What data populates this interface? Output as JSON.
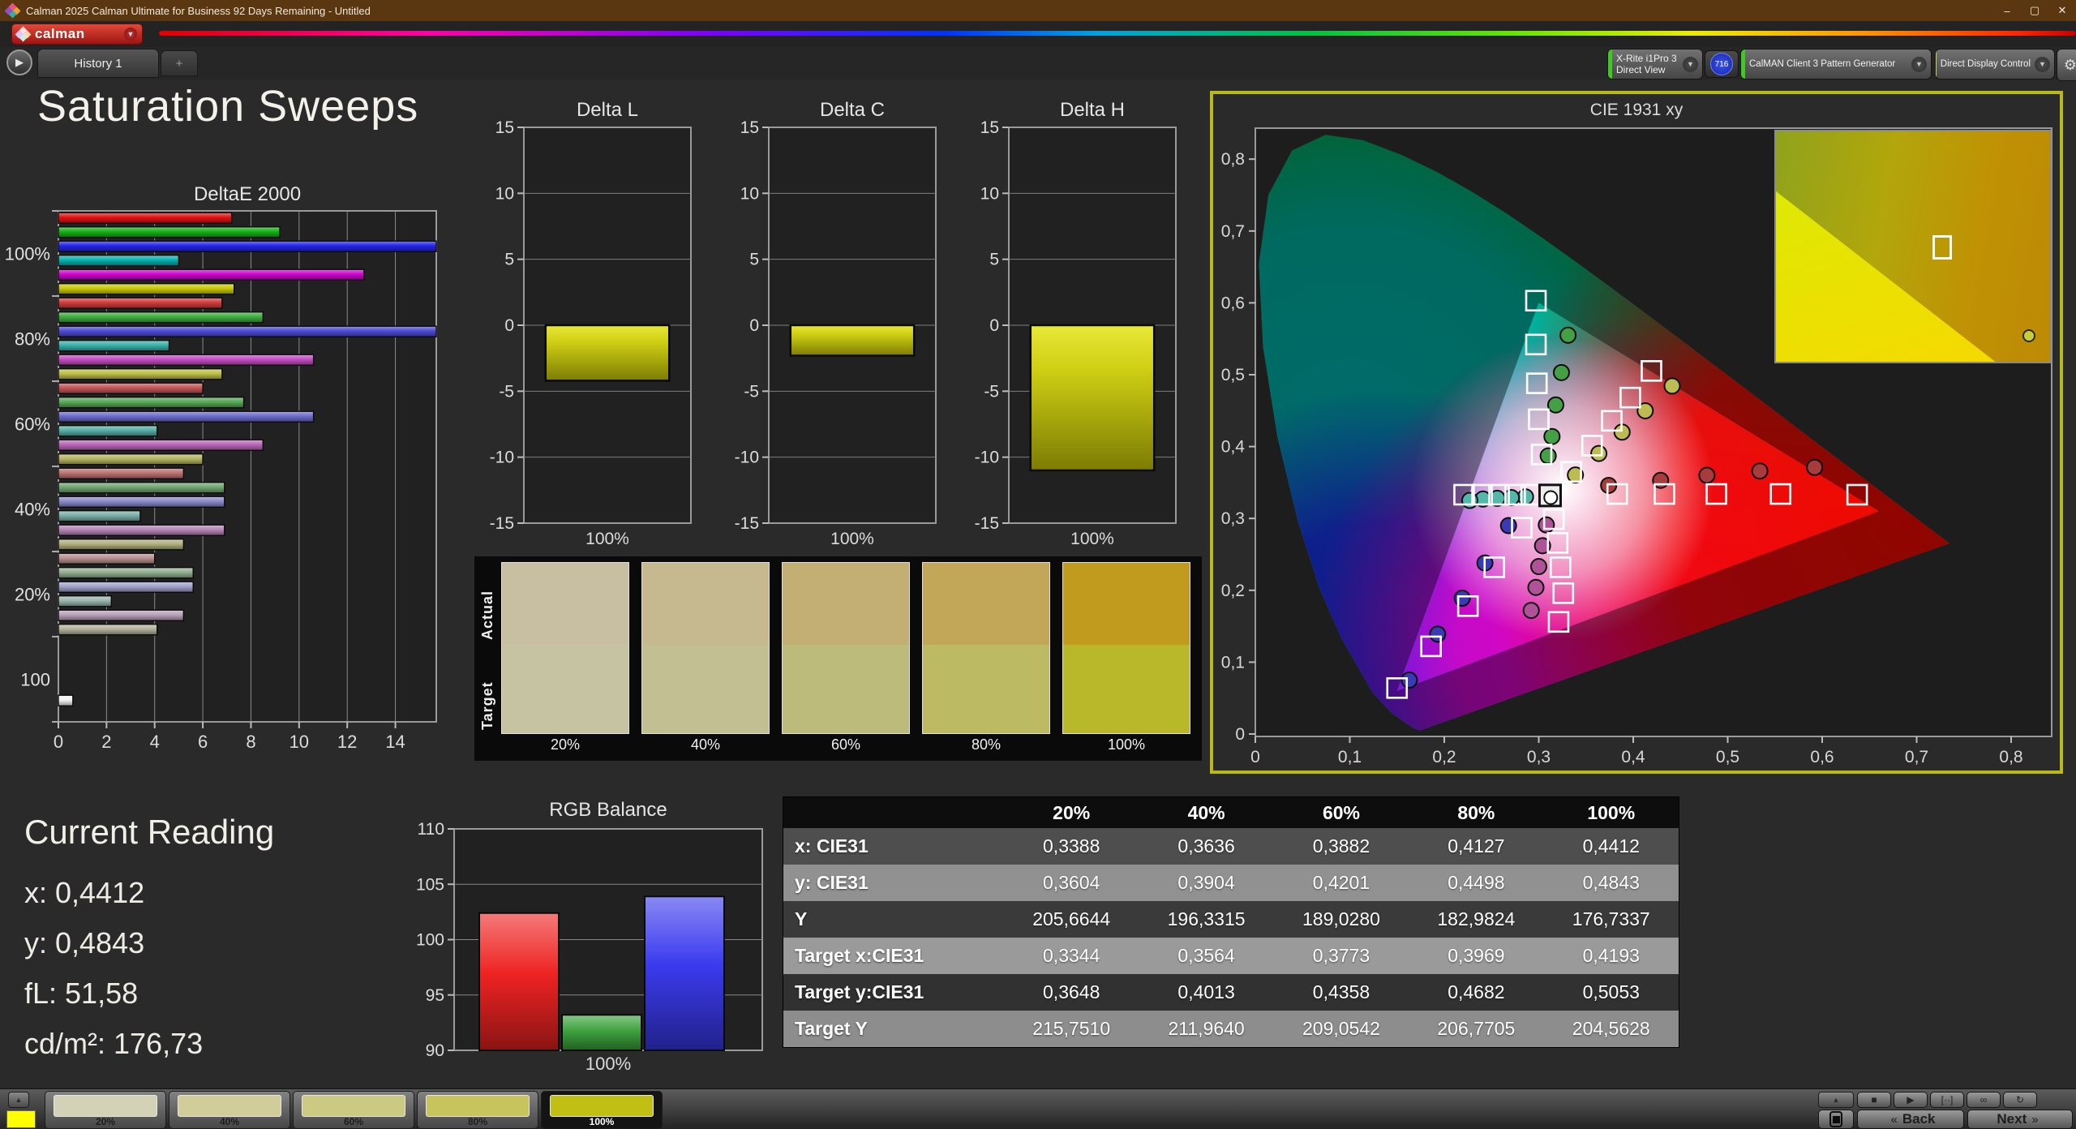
{
  "window": {
    "title": "Calman 2025 Calman Ultimate for Business 92 Days Remaining  - Untitled",
    "controls": {
      "minimize": "–",
      "maximize": "▢",
      "close": "✕"
    }
  },
  "menubar": {
    "brand": "calman"
  },
  "tabbar": {
    "history_tab": "History 1",
    "add_tab": "+"
  },
  "devicebar": {
    "meter": {
      "line1": "X-Rite i1Pro 3",
      "line2": "Direct View",
      "accent": "#3ecb1e"
    },
    "meter_badge": "716",
    "pattern_generator": {
      "label": "CalMAN Client 3 Pattern Generator",
      "accent": "#3ecb1e"
    },
    "display_control": {
      "label": "Direct Display Control",
      "accent": "#e3d600"
    }
  },
  "page": {
    "title": "Saturation Sweeps"
  },
  "current_reading": {
    "title": "Current Reading",
    "lines": [
      "x: 0,4412",
      "y: 0,4843",
      "fL: 51,58",
      "cd/m²: 176,73"
    ]
  },
  "transport": {
    "back": "Back",
    "next": "Next",
    "back_chev": "«",
    "next_chev": "»",
    "icons": [
      "■",
      "▶",
      "[··]",
      "∞",
      "↻"
    ]
  },
  "patterns": {
    "swatch_color": "#ffff00",
    "active_index": 4,
    "items": [
      {
        "label": "20%",
        "color": "#d4d2b6"
      },
      {
        "label": "40%",
        "color": "#d0cd9b"
      },
      {
        "label": "60%",
        "color": "#cbc982"
      },
      {
        "label": "80%",
        "color": "#c7c45e"
      },
      {
        "label": "100%",
        "color": "#c1be14"
      }
    ]
  },
  "chart_data": [
    {
      "id": "deltae",
      "type": "bar",
      "orientation": "horizontal",
      "title": "DeltaE 2000",
      "groups": [
        "100%",
        "80%",
        "60%",
        "40%",
        "20%",
        "100"
      ],
      "series_names": [
        "red",
        "green",
        "blue",
        "cyan",
        "magenta",
        "yellow"
      ],
      "values": [
        [
          7.2,
          9.2,
          16,
          5.0,
          12.7,
          7.3
        ],
        [
          6.8,
          8.5,
          16,
          4.6,
          10.6,
          6.8
        ],
        [
          6.0,
          7.7,
          10.6,
          4.1,
          8.5,
          6.0
        ],
        [
          5.2,
          6.9,
          6.9,
          3.4,
          6.9,
          5.2
        ],
        [
          4.0,
          5.6,
          5.6,
          2.2,
          5.2,
          4.1
        ],
        [
          0.6
        ]
      ],
      "colors": [
        [
          "#e11212",
          "#16b216",
          "#2424ea",
          "#06b2b2",
          "#ce06ce",
          "#c9c906"
        ],
        [
          "#d23c3c",
          "#3fae3f",
          "#4c4cd8",
          "#3ab2ac",
          "#c44ec4",
          "#bfbf48"
        ],
        [
          "#c65656",
          "#57a957",
          "#6c6cce",
          "#57b0a8",
          "#bb68bb",
          "#b6b663"
        ],
        [
          "#bf7272",
          "#72a872",
          "#8a8ac9",
          "#7ab0a8",
          "#b586b5",
          "#b1b180"
        ],
        [
          "#ba9191",
          "#92b092",
          "#a2a2cc",
          "#9ab4ae",
          "#b9a2b9",
          "#b3b39c"
        ],
        [
          "#f4f4f4"
        ]
      ],
      "xticks": [
        0,
        2,
        4,
        6,
        8,
        10,
        12,
        14
      ],
      "xmax": 15.7,
      "grid": true
    },
    {
      "id": "delta_l",
      "type": "bar",
      "title": "Delta L",
      "xlabel": "100%",
      "value": -4.2,
      "ylim": [
        -15,
        15
      ],
      "yticks": [
        15,
        10,
        5,
        0,
        -5,
        -10,
        -15
      ],
      "bar_top": "#e8e838",
      "bar_mid": "#cfcf14",
      "bar_bottom": "#7c7c04"
    },
    {
      "id": "delta_c",
      "type": "bar",
      "title": "Delta C",
      "xlabel": "100%",
      "value": -2.3,
      "ylim": [
        -15,
        15
      ],
      "yticks": [
        15,
        10,
        5,
        0,
        -5,
        -10,
        -15
      ],
      "bar_top": "#e8e838",
      "bar_mid": "#cfcf14",
      "bar_bottom": "#7c7c04"
    },
    {
      "id": "delta_h",
      "type": "bar",
      "title": "Delta H",
      "xlabel": "100%",
      "value": -11.0,
      "ylim": [
        -15,
        15
      ],
      "yticks": [
        15,
        10,
        5,
        0,
        -5,
        -10,
        -15
      ],
      "bar_top": "#e8e838",
      "bar_mid": "#cfcf14",
      "bar_bottom": "#7c7c04"
    },
    {
      "id": "actual_target_swatches",
      "type": "table",
      "row_labels": [
        "Actual",
        "Target"
      ],
      "items": [
        {
          "label": "20%",
          "actual": "#c8bfa3",
          "target": "#c5c3a2"
        },
        {
          "label": "40%",
          "actual": "#c6b88f",
          "target": "#c2c093"
        },
        {
          "label": "60%",
          "actual": "#c3ae74",
          "target": "#bdbb7c"
        },
        {
          "label": "80%",
          "actual": "#c1a757",
          "target": "#bcba62"
        },
        {
          "label": "100%",
          "actual": "#c19b1e",
          "target": "#b9b72a"
        }
      ]
    },
    {
      "id": "cie1931",
      "type": "scatter",
      "title": "CIE 1931 xy",
      "xticks": [
        "0",
        "0,1",
        "0,2",
        "0,3",
        "0,4",
        "0,5",
        "0,6",
        "0,7",
        "0,8"
      ],
      "yticks": [
        "0",
        "0,1",
        "0,2",
        "0,3",
        "0,4",
        "0,5",
        "0,6",
        "0,7",
        "0,8"
      ],
      "xlim": [
        0,
        0.843
      ],
      "ylim": [
        0,
        0.843
      ],
      "gamut_triangle": [
        [
          0.66,
          0.31
        ],
        [
          0.3,
          0.6
        ],
        [
          0.15,
          0.06
        ]
      ],
      "white_target": [
        0.312,
        0.332
      ],
      "white_measured": [
        0.3127,
        0.329
      ],
      "targets": {
        "red": [
          [
            0.383,
            0.334
          ],
          [
            0.433,
            0.334
          ],
          [
            0.488,
            0.334
          ],
          [
            0.556,
            0.334
          ],
          [
            0.637,
            0.333
          ]
        ],
        "green": [
          [
            0.303,
            0.389
          ],
          [
            0.3,
            0.438
          ],
          [
            0.298,
            0.488
          ],
          [
            0.297,
            0.542
          ],
          [
            0.297,
            0.603
          ]
        ],
        "blue": [
          [
            0.282,
            0.287
          ],
          [
            0.253,
            0.232
          ],
          [
            0.225,
            0.178
          ],
          [
            0.186,
            0.122
          ],
          [
            0.15,
            0.064
          ]
        ],
        "cyan": [
          [
            0.292,
            0.333
          ],
          [
            0.275,
            0.333
          ],
          [
            0.258,
            0.333
          ],
          [
            0.24,
            0.333
          ],
          [
            0.221,
            0.333
          ]
        ],
        "magenta": [
          [
            0.316,
            0.299
          ],
          [
            0.32,
            0.266
          ],
          [
            0.323,
            0.232
          ],
          [
            0.326,
            0.196
          ],
          [
            0.321,
            0.156
          ]
        ],
        "yellow": [
          [
            0.3344,
            0.3648
          ],
          [
            0.3564,
            0.4013
          ],
          [
            0.3773,
            0.4358
          ],
          [
            0.3969,
            0.4682
          ],
          [
            0.4193,
            0.5053
          ]
        ]
      },
      "measured": {
        "red": [
          [
            0.374,
            0.346
          ],
          [
            0.429,
            0.353
          ],
          [
            0.478,
            0.36
          ],
          [
            0.534,
            0.366
          ],
          [
            0.592,
            0.371
          ]
        ],
        "green": [
          [
            0.31,
            0.387
          ],
          [
            0.314,
            0.414
          ],
          [
            0.318,
            0.458
          ],
          [
            0.324,
            0.503
          ],
          [
            0.331,
            0.555
          ]
        ],
        "blue": [
          [
            0.268,
            0.29
          ],
          [
            0.243,
            0.238
          ],
          [
            0.219,
            0.189
          ],
          [
            0.193,
            0.139
          ],
          [
            0.163,
            0.075
          ]
        ],
        "cyan": [
          [
            0.286,
            0.33
          ],
          [
            0.271,
            0.329
          ],
          [
            0.256,
            0.328
          ],
          [
            0.241,
            0.327
          ],
          [
            0.227,
            0.325
          ]
        ],
        "magenta": [
          [
            0.308,
            0.291
          ],
          [
            0.304,
            0.262
          ],
          [
            0.3,
            0.233
          ],
          [
            0.297,
            0.204
          ],
          [
            0.292,
            0.172
          ]
        ],
        "yellow": [
          [
            0.3388,
            0.3604
          ],
          [
            0.3636,
            0.3904
          ],
          [
            0.3882,
            0.4201
          ],
          [
            0.4127,
            0.4498
          ],
          [
            0.4412,
            0.4843
          ]
        ]
      },
      "marker_fill": {
        "red": "#a83c3c",
        "green": "#44a044",
        "blue": "#3a3ab4",
        "cyan": "#52b8aa",
        "magenta": "#b05298",
        "yellow": "#bcbc52"
      },
      "inset": {
        "square": [
          0.57,
          0.45
        ],
        "circle": [
          0.9,
          0.86
        ]
      }
    },
    {
      "id": "rgb_balance",
      "type": "bar",
      "title": "RGB Balance",
      "xlabel": "100%",
      "categories": [
        "Red",
        "Green",
        "Blue"
      ],
      "values": [
        102.4,
        93.2,
        103.9
      ],
      "colors": [
        "#ee2222",
        "#3da23d",
        "#3a3aee"
      ],
      "ylim": [
        90,
        110
      ],
      "yticks": [
        110,
        105,
        100,
        95,
        90
      ]
    },
    {
      "id": "measurement_table",
      "type": "table",
      "columns": [
        "20%",
        "40%",
        "60%",
        "80%",
        "100%"
      ],
      "rows": [
        {
          "label": "x: CIE31",
          "values": [
            "0,3388",
            "0,3636",
            "0,3882",
            "0,4127",
            "0,4412"
          ],
          "bg": "#4e4e4e"
        },
        {
          "label": "y: CIE31",
          "values": [
            "0,3604",
            "0,3904",
            "0,4201",
            "0,4498",
            "0,4843"
          ],
          "bg": "#919191"
        },
        {
          "label": "Y",
          "values": [
            "205,6644",
            "196,3315",
            "189,0280",
            "182,9824",
            "176,7337"
          ],
          "bg": "#3a3a3a"
        },
        {
          "label": "Target x:CIE31",
          "values": [
            "0,3344",
            "0,3564",
            "0,3773",
            "0,3969",
            "0,4193"
          ],
          "bg": "#9a9a9a"
        },
        {
          "label": "Target y:CIE31",
          "values": [
            "0,3648",
            "0,4013",
            "0,4358",
            "0,4682",
            "0,5053"
          ],
          "bg": "#313131"
        },
        {
          "label": "Target Y",
          "values": [
            "215,7510",
            "211,9640",
            "209,0542",
            "206,7705",
            "204,5628"
          ],
          "bg": "#8d8d8d"
        }
      ]
    }
  ]
}
